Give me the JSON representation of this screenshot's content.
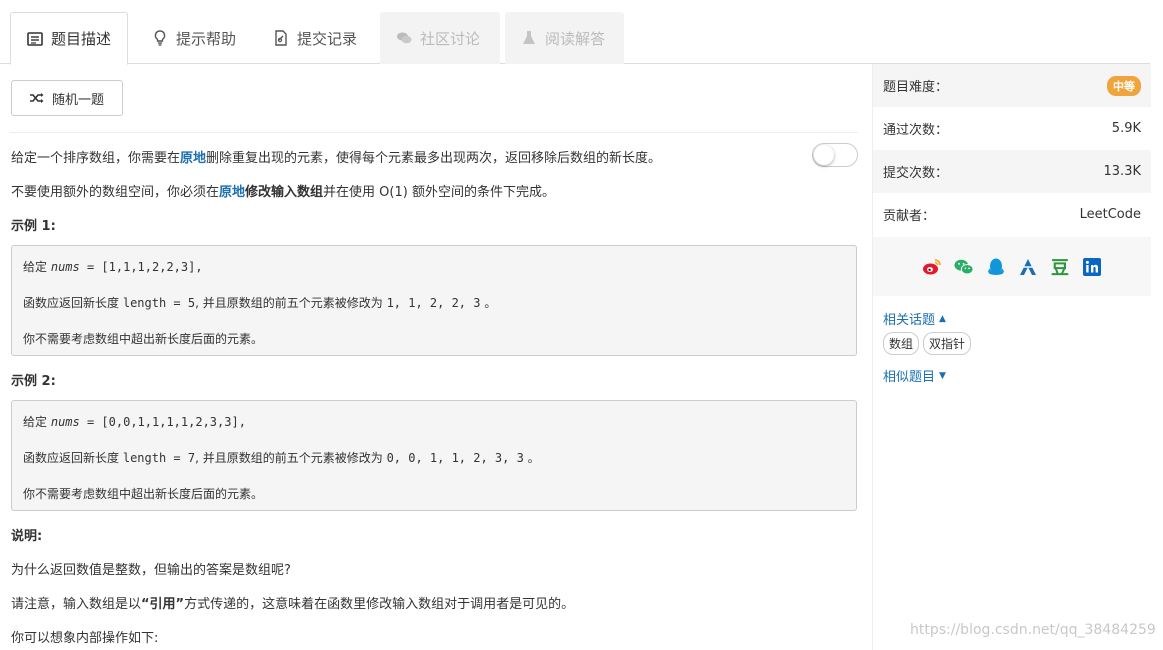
{
  "tabs": [
    {
      "label": "题目描述",
      "icon": "description-icon",
      "state": "active"
    },
    {
      "label": "提示帮助",
      "icon": "lightbulb-icon",
      "state": "normal"
    },
    {
      "label": "提交记录",
      "icon": "submission-icon",
      "state": "normal"
    },
    {
      "label": "社区讨论",
      "icon": "comments-icon",
      "state": "disabled"
    },
    {
      "label": "阅读解答",
      "icon": "flask-icon",
      "state": "disabled"
    }
  ],
  "toolbar": {
    "random_label": "随机一题",
    "random_icon": "shuffle-icon"
  },
  "description": {
    "p1_a": "给定一个排序数组，你需要在",
    "p1_b": "原地",
    "p1_c": "删除重复出现的元素，使得每个元素最多出现两次，返回移除后数组的新长度。",
    "p2_a": "不要使用额外的数组空间，你必须在",
    "p2_b": "原地",
    "p2_c": "修改输入数组",
    "p2_d": "并在使用 O(1) 额外空间的条件下完成。"
  },
  "example1": {
    "title": "示例 1:",
    "given": "给定",
    "var": "nums",
    "value": "= [1,1,1,2,2,3],",
    "ret_a": "函数应返回新长度",
    "ret_b": "length = 5",
    "ret_c": ", 并且原数组的前五个元素被修改为",
    "ret_d": "1, 1, 2, 2, 3",
    "ret_e": "。",
    "note": "你不需要考虑数组中超出新长度后面的元素。"
  },
  "example2": {
    "title": "示例 2:",
    "given": "给定",
    "var": "nums",
    "value": "= [0,0,1,1,1,1,2,3,3],",
    "ret_a": "函数应返回新长度",
    "ret_b": "length = 7",
    "ret_c": ", 并且原数组的前五个元素被修改为",
    "ret_d": "0, 0, 1, 1, 2, 3, 3",
    "ret_e": "。",
    "note": "你不需要考虑数组中超出新长度后面的元素。"
  },
  "explain": {
    "title": "说明:",
    "q": "为什么返回数值是整数，但输出的答案是数组呢?",
    "p_a": "请注意，输入数组是以",
    "p_b": "“引用”",
    "p_c": "方式传递的，这意味着在函数里修改输入数组对于调用者是可见的。",
    "p2": "你可以想象内部操作如下:"
  },
  "sidebar": {
    "difficulty_label": "题目难度：",
    "difficulty_value": "中等",
    "accepted_label": "通过次数：",
    "accepted_value": "5.9K",
    "submissions_label": "提交次数：",
    "submissions_value": "13.3K",
    "contributor_label": "贡献者：",
    "contributor_value": "LeetCode",
    "share_icons": [
      "weibo-icon",
      "wechat-icon",
      "qq-icon",
      "qzone-icon",
      "douban-icon",
      "linkedin-icon"
    ],
    "douban_glyph": "豆",
    "related_topics_label": "相关话题",
    "topics": [
      "数组",
      "双指针"
    ],
    "similar_label": "相似题目"
  },
  "watermark": "https://blog.csdn.net/qq_38484259",
  "colors": {
    "accent": "#1b6fb1",
    "badge": "#f0a43c"
  }
}
